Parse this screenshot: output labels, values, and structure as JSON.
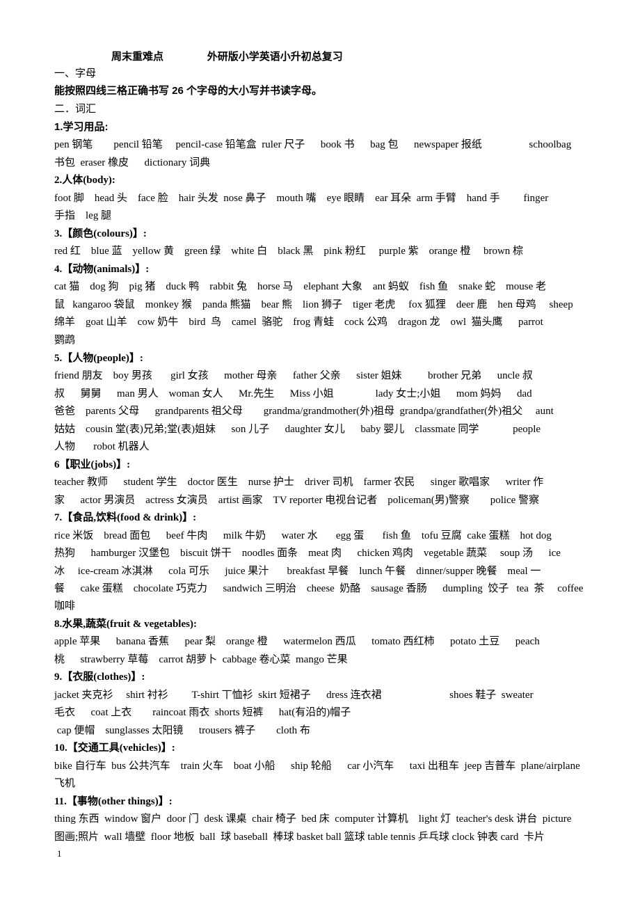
{
  "document": {
    "title_left": "周末重难点",
    "title_right": "外研版小学英语小升初总复习",
    "section1_heading": "一、字母",
    "section1_text": "能按照四线三格正确书写 26 个字母的大小写并书读字母。",
    "section2_heading": "二．词汇",
    "categories": [
      {
        "heading": "1.学习用品:",
        "lines": [
          "pen 钢笔        pencil 铅笔     pencil-case 铅笔盒  ruler 尺子      book 书      bag 包      newspaper 报纸                  schoolbag",
          "书包  eraser 橡皮      dictionary 词典"
        ]
      },
      {
        "heading": "2.人体(body):",
        "lines": [
          "foot 脚    head 头    face 脸    hair 头发  nose 鼻子    mouth 嘴    eye 眼睛    ear 耳朵  arm 手臂    hand 手         finger",
          "手指    leg 腿"
        ]
      },
      {
        "heading": "3.【颜色(colours)】:",
        "lines": [
          "red 红    blue 蓝    yellow 黄    green 绿    white 白    black 黑    pink 粉红     purple 紫    orange 橙     brown 棕"
        ]
      },
      {
        "heading": "4.【动物(animals)】:",
        "lines": [
          "cat 猫    dog 狗    pig 猪    duck 鸭    rabbit 兔    horse 马    elephant 大象    ant 蚂蚁    fish 鱼    snake 蛇    mouse 老",
          "鼠   kangaroo 袋鼠    monkey 猴    panda 熊猫    bear 熊    lion 狮子    tiger 老虎     fox 狐狸    deer 鹿    hen 母鸡     sheep",
          "绵羊    goat 山羊    cow 奶牛    bird  鸟    camel  骆驼    frog 青蛙    cock 公鸡    dragon 龙    owl  猫头鹰      parrot",
          "鹦鹉"
        ]
      },
      {
        "heading": "5.【人物(people)】:",
        "lines": [
          "friend 朋友    boy 男孩       girl 女孩      mother 母亲      father 父亲      sister 姐妹          brother 兄弟      uncle 叔",
          "叔      舅舅      man 男人    woman 女人      Mr.先生      Miss 小姐                lady 女士;小姐      mom 妈妈      dad",
          "爸爸    parents 父母      grandparents 祖父母        grandma/grandmother(外)祖母  grandpa/grandfather(外)祖父     aunt",
          "姑姑    cousin 堂(表)兄弟;堂(表)姐妹      son 儿子      daughter 女儿      baby 婴儿    classmate 同学             people",
          "人物       robot 机器人"
        ]
      },
      {
        "heading": "6【职业(jobs)】:",
        "lines": [
          "teacher 教师      student 学生    doctor 医生    nurse 护士    driver 司机    farmer 农民      singer 歌唱家      writer 作",
          "家      actor 男演员    actress 女演员    artist 画家    TV reporter 电视台记者    policeman(男)警察        police 警察"
        ]
      },
      {
        "heading": "7.【食品,饮料(food & drink)】:",
        "lines": [
          "rice 米饭    bread 面包      beef 牛肉      milk 牛奶      water 水       egg 蛋       fish 鱼    tofu 豆腐  cake 蛋糕    hot dog",
          "热狗      hamburger 汉堡包    biscuit 饼干    noodles 面条    meat 肉      chicken 鸡肉    vegetable 蔬菜     soup 汤      ice",
          "冰     ice-cream 冰淇淋      cola 可乐      juice 果汁       breakfast 早餐    lunch 午餐    dinner/supper 晚餐    meal 一",
          "餐      cake 蛋糕    chocolate 巧克力      sandwich 三明治    cheese  奶酪    sausage 香肠      dumpling  饺子   tea  茶     coffee",
          "咖啡"
        ]
      },
      {
        "heading": "8.水果,蔬菜(fruit & vegetables):",
        "lines": [
          "apple 苹果      banana 香蕉      pear 梨    orange 橙      watermelon 西瓜      tomato 西红柿      potato 土豆      peach",
          "桃      strawberry 草莓    carrot 胡萝卜  cabbage 卷心菜  mango 芒果"
        ]
      },
      {
        "heading": "9.【衣服(clothes)】:",
        "lines": [
          "jacket 夹克衫     shirt 衬衫         T-shirt 丅恤衫  skirt 短裙子      dress 连衣裙                          shoes 鞋子  sweater",
          "毛衣      coat 上衣        raincoat 雨衣  shorts 短裤      hat(有沿的)帽子",
          " cap 便帽    sunglasses 太阳镜      trousers 裤子        cloth 布"
        ]
      },
      {
        "heading": "10.【交通工具(vehicles)】:",
        "lines": [
          "bike 自行车  bus 公共汽车    train 火车    boat 小船      ship 轮船      car 小汽车      taxi 出租车  jeep 吉普车  plane/airplane",
          "飞机"
        ]
      },
      {
        "heading": "11.【事物(other things)】:",
        "lines": [
          "thing 东西  window 窗户  door 门  desk 课桌  chair 椅子  bed 床  computer 计算机    light 灯  teacher's desk 讲台  picture",
          "图画;照片  wall 墙壁  floor 地板  ball  球 baseball  棒球 basket ball 篮球 table tennis 乒乓球 clock 钟表 card  卡片"
        ]
      }
    ],
    "page_number": "1"
  }
}
